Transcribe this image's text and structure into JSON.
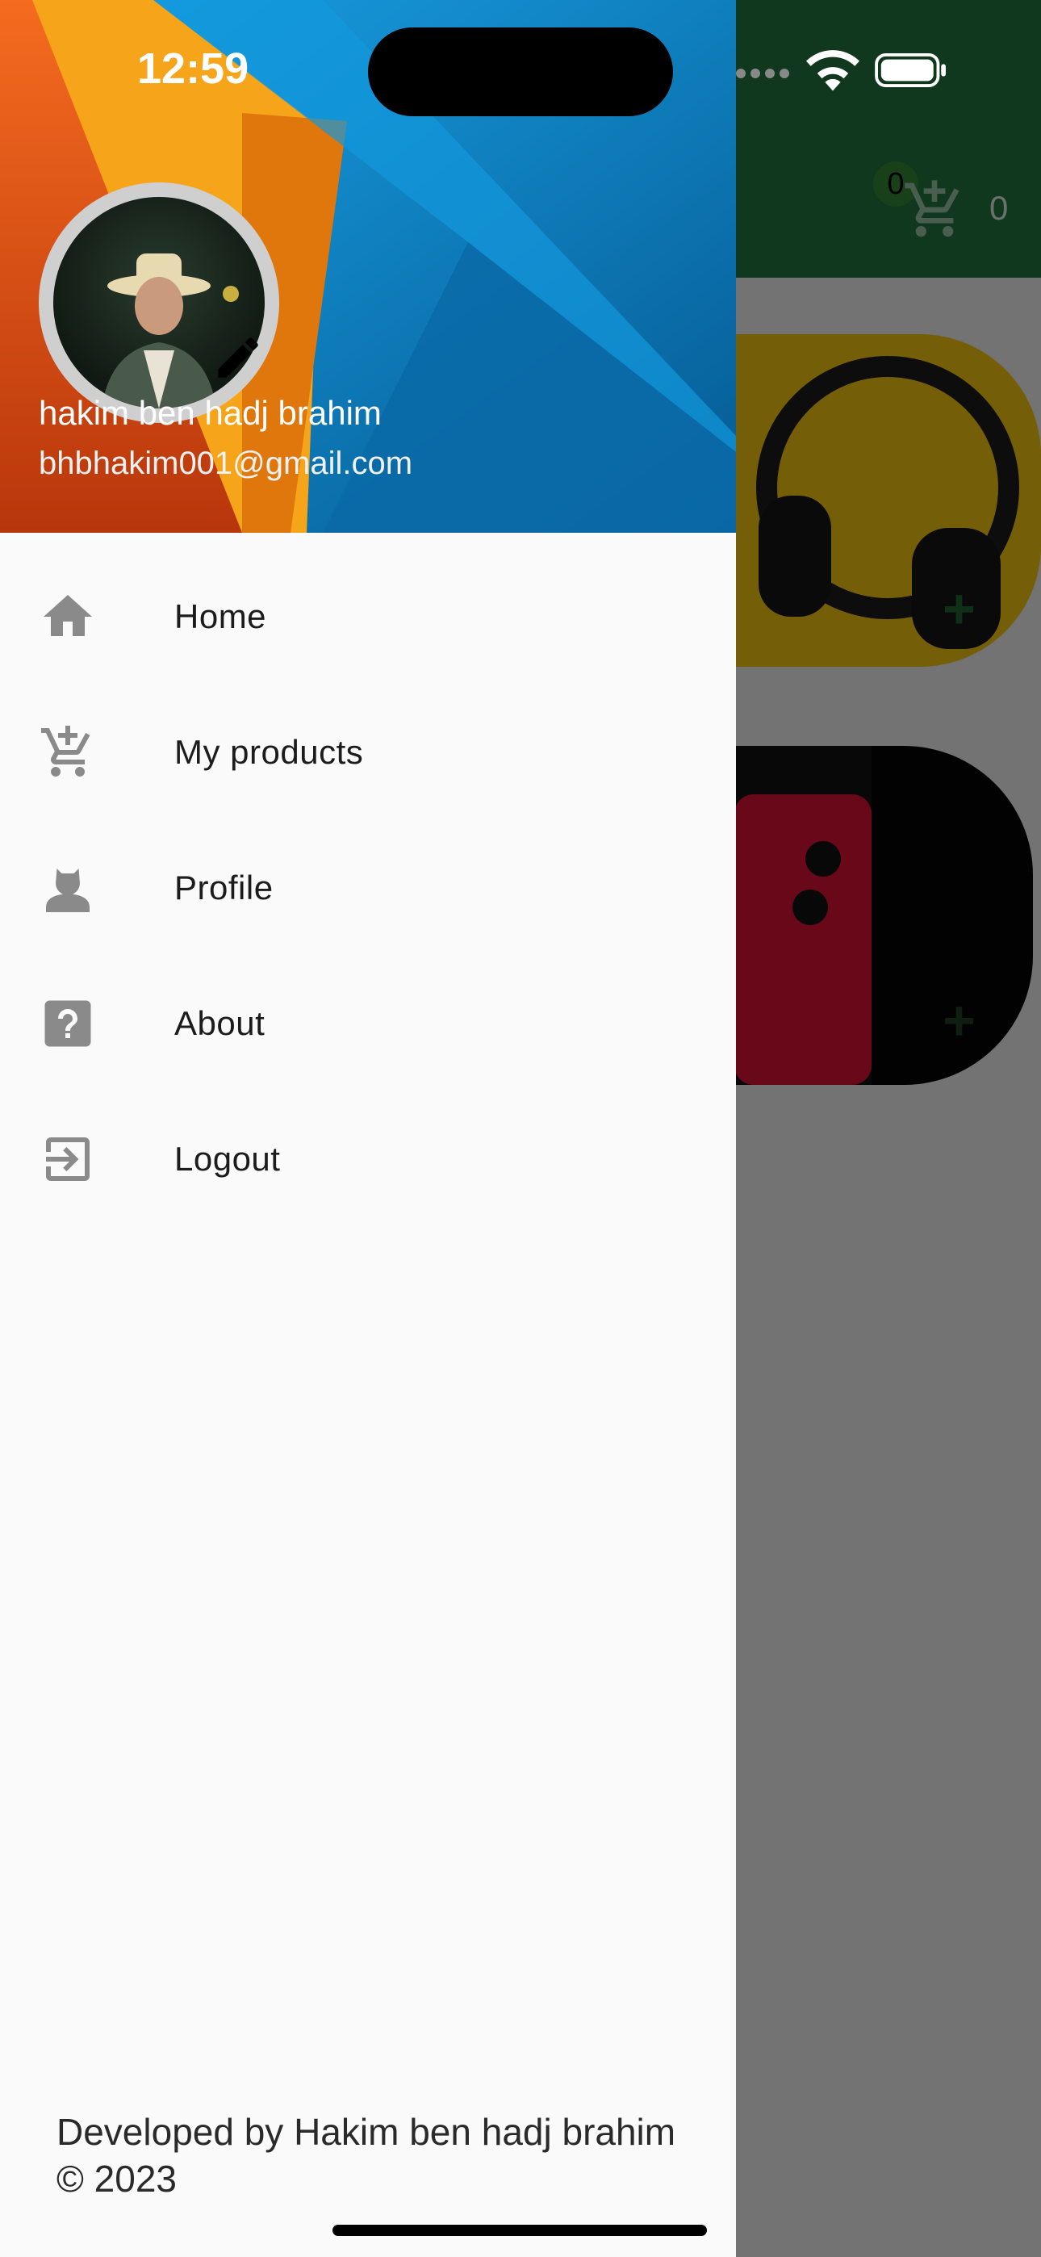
{
  "status_bar": {
    "time": "12:59"
  },
  "background_app": {
    "cart_badge_count": "0",
    "cart_count": "0",
    "add_symbol": "+",
    "colors": {
      "appbar": "#1f6b3a",
      "card_1": "#e0b411",
      "card_2": "#050505"
    }
  },
  "drawer": {
    "user": {
      "name": "hakim ben hadj brahim",
      "email": "bhbhakim001@gmail.com"
    },
    "menu": [
      {
        "label": "Home",
        "icon": "home-icon"
      },
      {
        "label": "My products",
        "icon": "add-shopping-cart-icon"
      },
      {
        "label": "Profile",
        "icon": "person-icon"
      },
      {
        "label": "About",
        "icon": "help-icon"
      },
      {
        "label": "Logout",
        "icon": "login-icon"
      }
    ],
    "footer": "Developed by Hakim ben hadj brahim © 2023",
    "colors": {
      "icon": "#8a8a8a",
      "drawer_bg": "#fafafa"
    }
  }
}
